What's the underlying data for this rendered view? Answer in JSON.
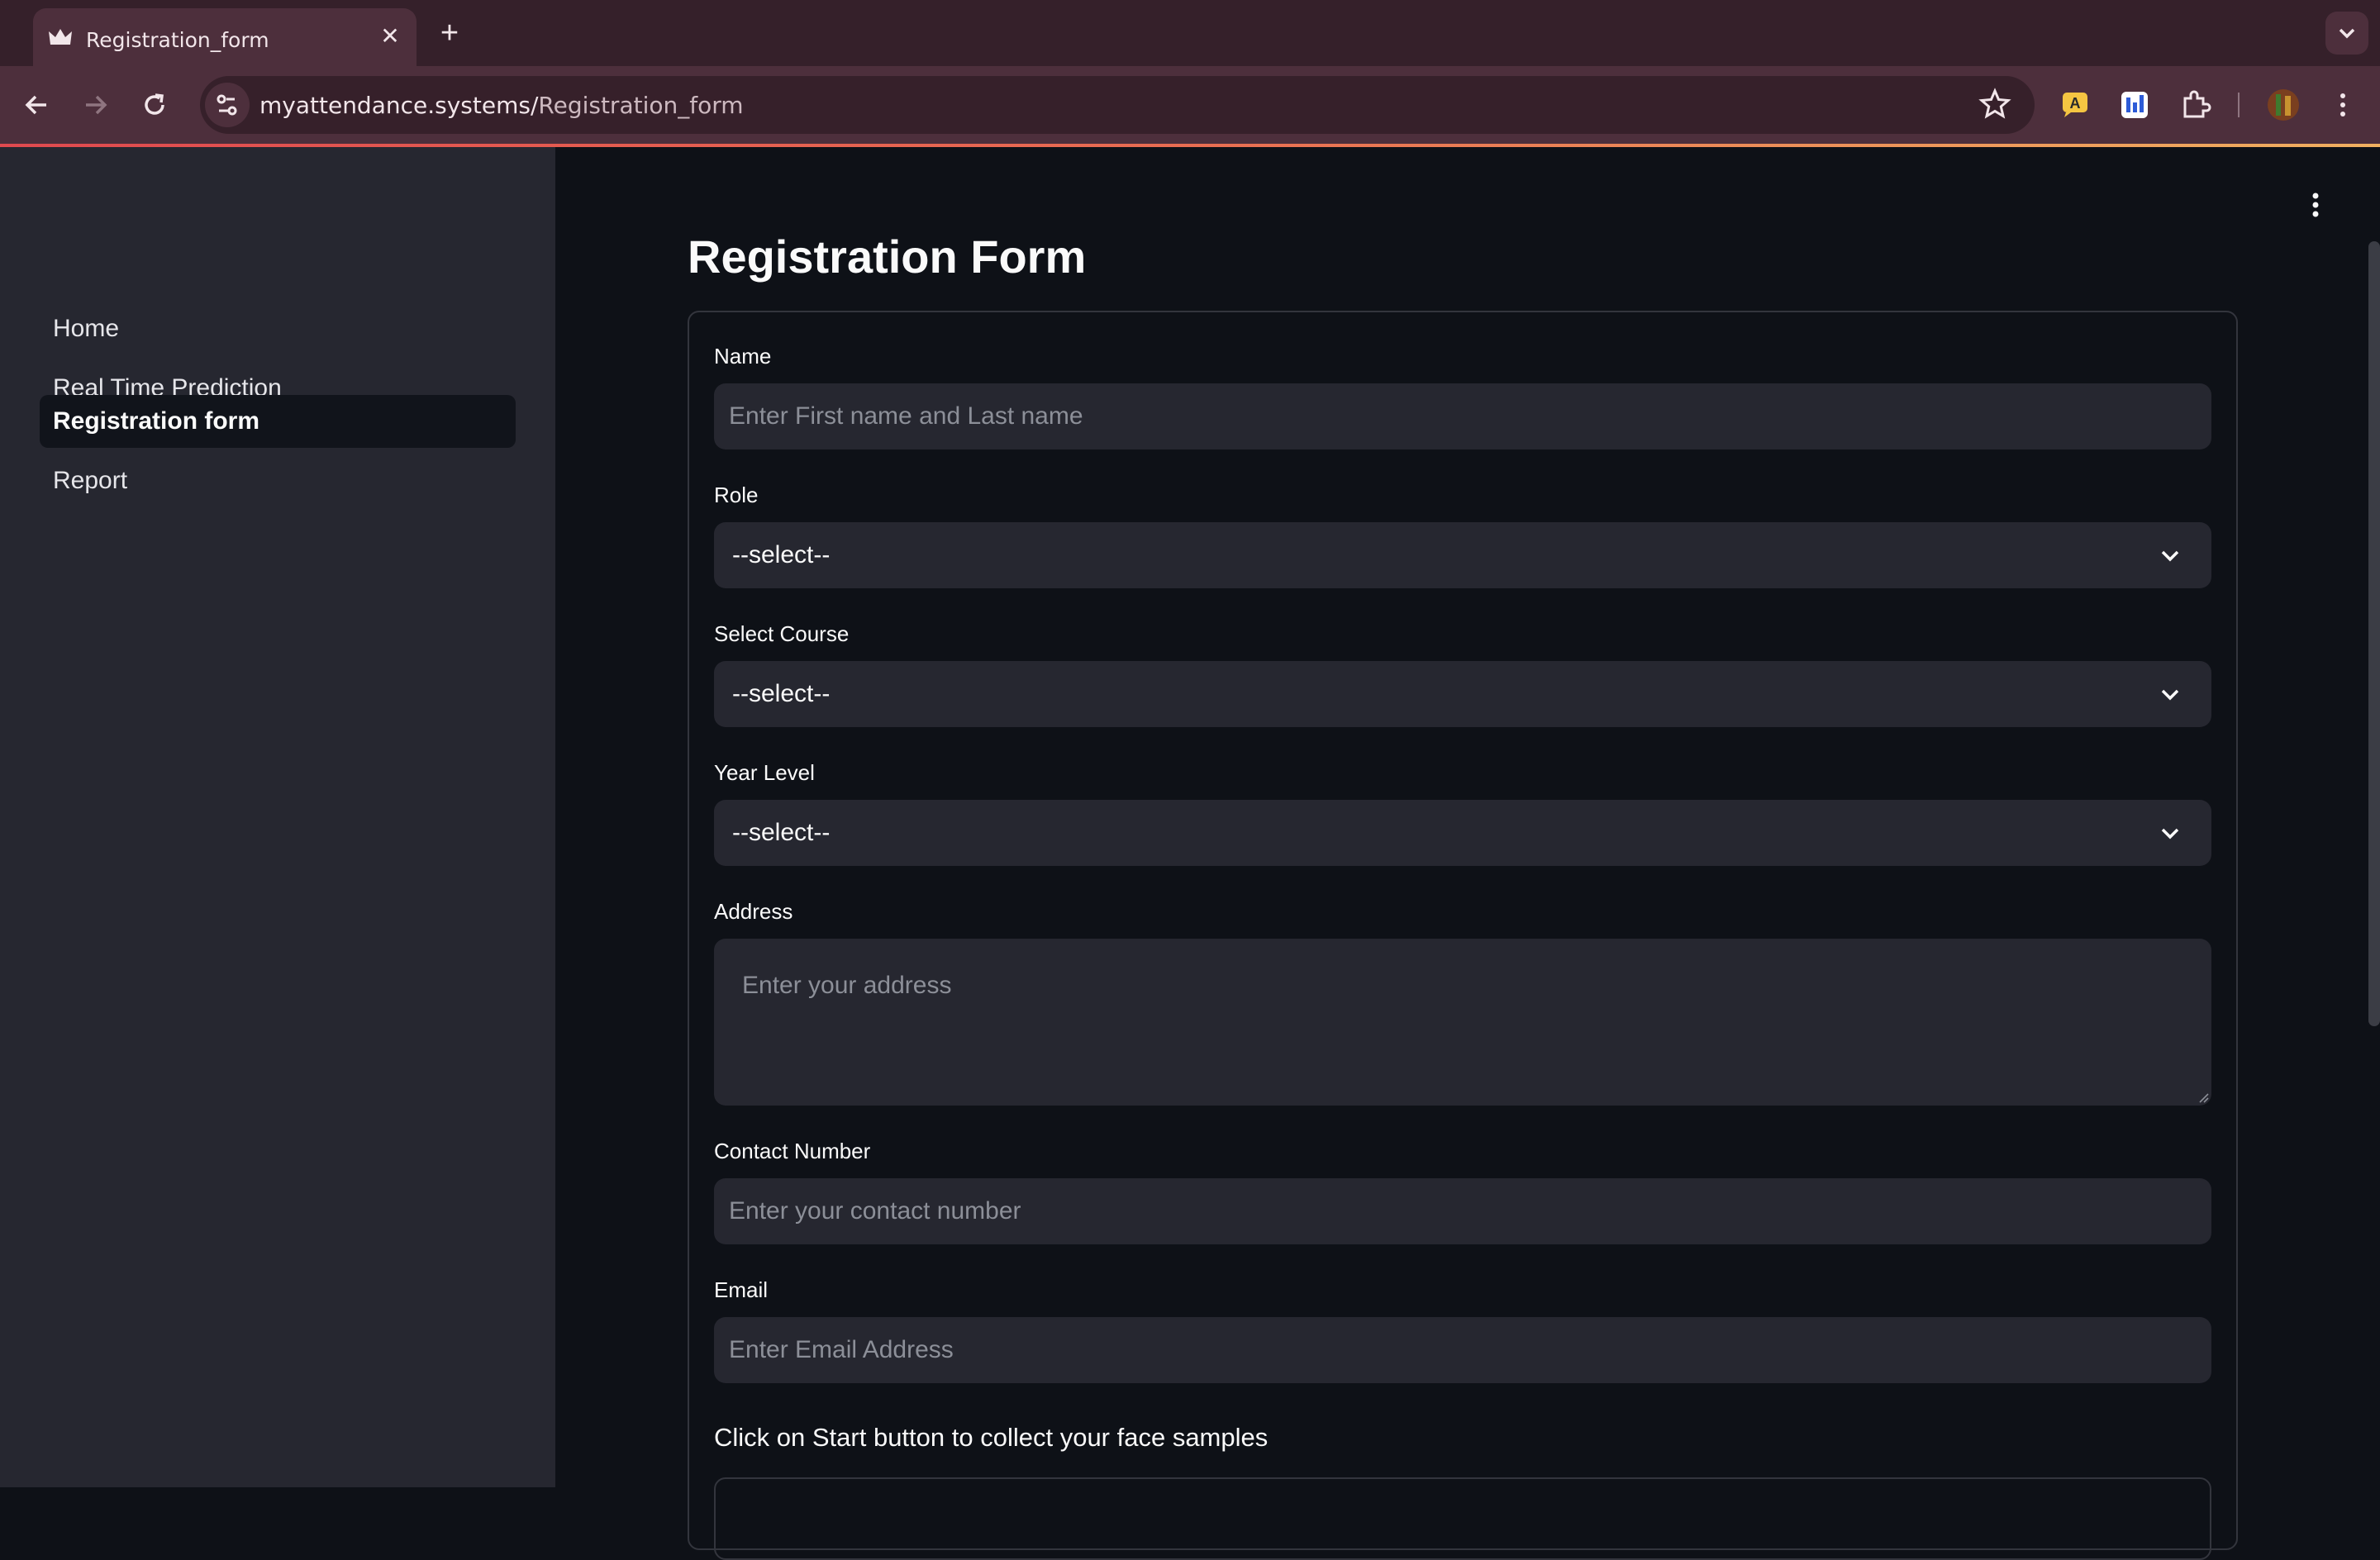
{
  "browser": {
    "tab_title": "Registration_form",
    "url_host": "myattendance.systems/",
    "url_path": "Registration_form"
  },
  "sidebar": {
    "items": [
      {
        "label": "Home"
      },
      {
        "label": "Real Time Prediction"
      },
      {
        "label": "Registration form",
        "active": true
      },
      {
        "label": "Report"
      }
    ]
  },
  "page": {
    "title": "Registration Form"
  },
  "form": {
    "name": {
      "label": "Name",
      "placeholder": "Enter First name and Last name"
    },
    "role": {
      "label": "Role",
      "value": "--select--"
    },
    "course": {
      "label": "Select Course",
      "value": "--select--"
    },
    "year": {
      "label": "Year Level",
      "value": "--select--"
    },
    "address": {
      "label": "Address",
      "placeholder": "Enter your address"
    },
    "contact": {
      "label": "Contact Number",
      "placeholder": "Enter your contact number"
    },
    "email": {
      "label": "Email",
      "placeholder": "Enter Email Address"
    },
    "instruction": "Click on Start button to collect your face samples"
  },
  "colors": {
    "app_bg": "#0e1117",
    "sidebar_bg": "#262730",
    "input_bg": "#262730",
    "browser_frame": "#4d2f3c"
  }
}
